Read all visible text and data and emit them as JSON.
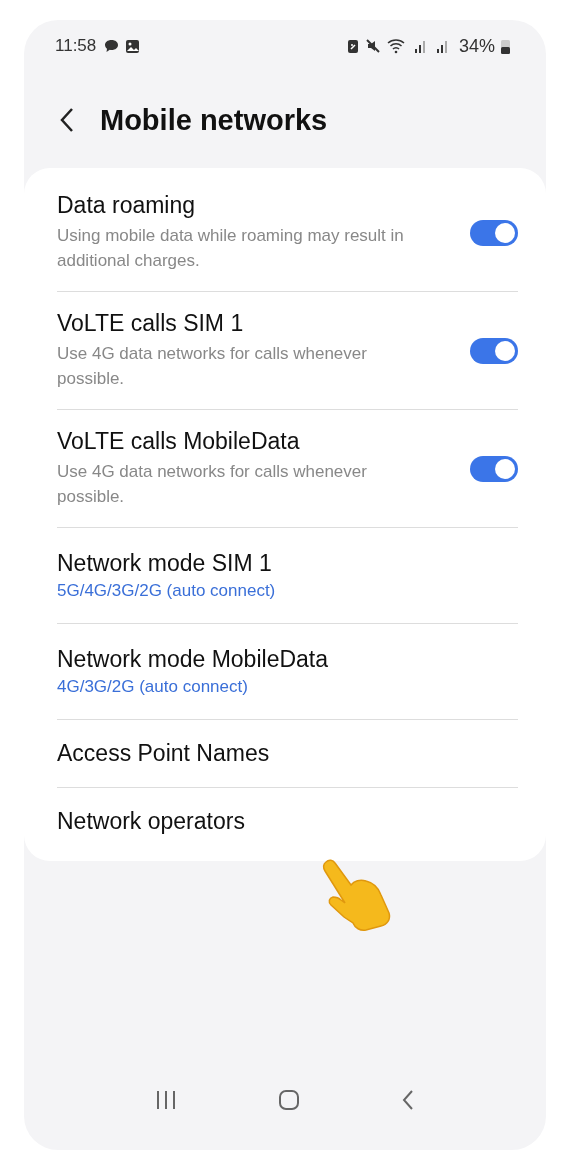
{
  "status_bar": {
    "time": "11:58",
    "battery": "34%"
  },
  "header": {
    "title": "Mobile networks"
  },
  "items": [
    {
      "kind": "toggle",
      "title": "Data roaming",
      "subtitle": "Using mobile data while roaming may result in additional charges.",
      "on": true
    },
    {
      "kind": "toggle",
      "title": "VoLTE calls SIM 1",
      "subtitle": "Use 4G data networks for calls whenever possible.",
      "on": true
    },
    {
      "kind": "toggle",
      "title": "VoLTE calls MobileData",
      "subtitle": "Use 4G data networks for calls whenever possible.",
      "on": true
    },
    {
      "kind": "value",
      "title": "Network mode SIM 1",
      "value": "5G/4G/3G/2G (auto connect)"
    },
    {
      "kind": "value",
      "title": "Network mode MobileData",
      "value": "4G/3G/2G (auto connect)"
    },
    {
      "kind": "plain",
      "title": "Access Point Names"
    },
    {
      "kind": "plain",
      "title": "Network operators"
    }
  ]
}
